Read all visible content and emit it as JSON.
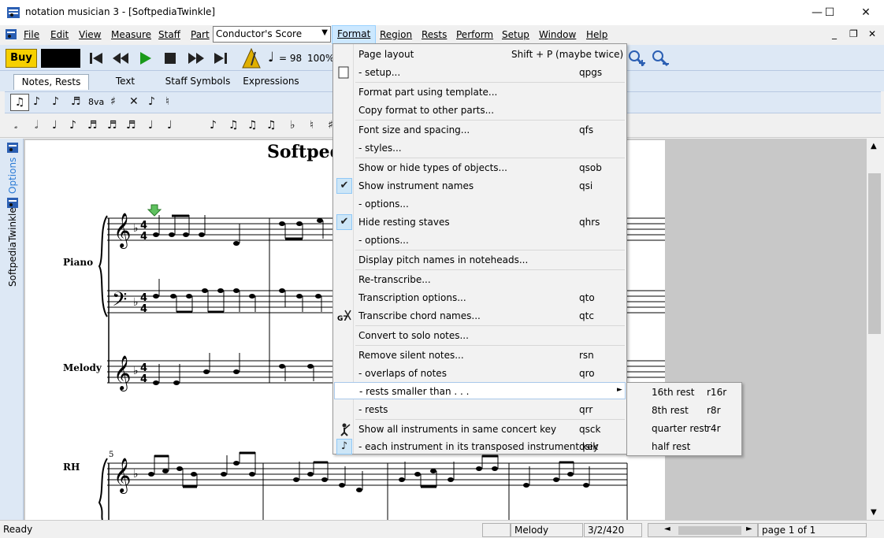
{
  "window": {
    "title": "notation musician 3 - [SoftpediaTwinkle]",
    "minimize_glyph": "—",
    "maximize_glyph": "☐",
    "close_glyph": "✕"
  },
  "menubar": {
    "items": [
      "File",
      "Edit",
      "View",
      "Measure",
      "Staff",
      "Part"
    ],
    "score_select": "Conductor's Score",
    "items_right": [
      "Format",
      "Region",
      "Rests",
      "Perform",
      "Setup",
      "Window",
      "Help"
    ],
    "mdi_min": "_",
    "mdi_restore": "❐",
    "mdi_close": "✕"
  },
  "transport": {
    "buy_label": "Buy",
    "tempo": "= 98",
    "zoom": "100%"
  },
  "tabs": [
    "Notes, Rests",
    "Text",
    "Staff Symbols",
    "Expressions"
  ],
  "notebar1": {
    "octave_label": "8va"
  },
  "sidebar": {
    "options_label": "Options",
    "document_label": "SoftpediaTwinkle"
  },
  "score": {
    "title": "Softpedi",
    "staff_labels": [
      "Piano",
      "Melody",
      "RH"
    ],
    "measure_number": "5"
  },
  "format_menu": {
    "items": [
      {
        "label": "Page layout",
        "shortcut": "Shift + P (maybe twice)"
      },
      {
        "label": "-       setup...",
        "shortcut": "qpgs"
      },
      {
        "label": "Format part using template...",
        "shortcut": ""
      },
      {
        "label": "Copy format to other parts...",
        "shortcut": ""
      },
      {
        "label": "Font size and spacing...",
        "shortcut": "qfs"
      },
      {
        "label": "-       styles...",
        "shortcut": ""
      },
      {
        "label": "Show or hide types of objects...",
        "shortcut": "qsob"
      },
      {
        "label": "Show instrument names",
        "shortcut": "qsi"
      },
      {
        "label": "-       options...",
        "shortcut": ""
      },
      {
        "label": "Hide resting staves",
        "shortcut": "qhrs"
      },
      {
        "label": "-       options...",
        "shortcut": ""
      },
      {
        "label": "Display pitch names in noteheads...",
        "shortcut": ""
      },
      {
        "label": "Re-transcribe...",
        "shortcut": ""
      },
      {
        "label": "Transcription options...",
        "shortcut": "qto"
      },
      {
        "label": "Transcribe chord names...",
        "shortcut": "qtc"
      },
      {
        "label": "Convert to solo notes...",
        "shortcut": ""
      },
      {
        "label": "Remove silent notes...",
        "shortcut": "rsn"
      },
      {
        "label": "-       overlaps of notes",
        "shortcut": "qro"
      },
      {
        "label": "-       rests smaller than . . .",
        "shortcut": ""
      },
      {
        "label": "-       rests",
        "shortcut": "qrr"
      },
      {
        "label": "Show all instruments in same concert key",
        "shortcut": "qsck"
      },
      {
        "label": "-       each instrument in its transposed instrument key",
        "shortcut": "qsik"
      }
    ],
    "submenu_arrow": "►"
  },
  "rests_submenu": [
    {
      "label": "16th rest",
      "shortcut": "r16r"
    },
    {
      "label": "8th rest",
      "shortcut": "r8r"
    },
    {
      "label": "quarter rest",
      "shortcut": "r4r"
    },
    {
      "label": "half rest",
      "shortcut": ""
    }
  ],
  "statusbar": {
    "status": "Ready",
    "staff": "Melody",
    "position": "3/2/420",
    "page": "page 1 of 1"
  },
  "colors": {
    "toolbar_bg": "#dde8f5",
    "menu_highlight": "#cce8ff",
    "buy_button": "#f6d000",
    "play_green": "#1a9a1a"
  }
}
